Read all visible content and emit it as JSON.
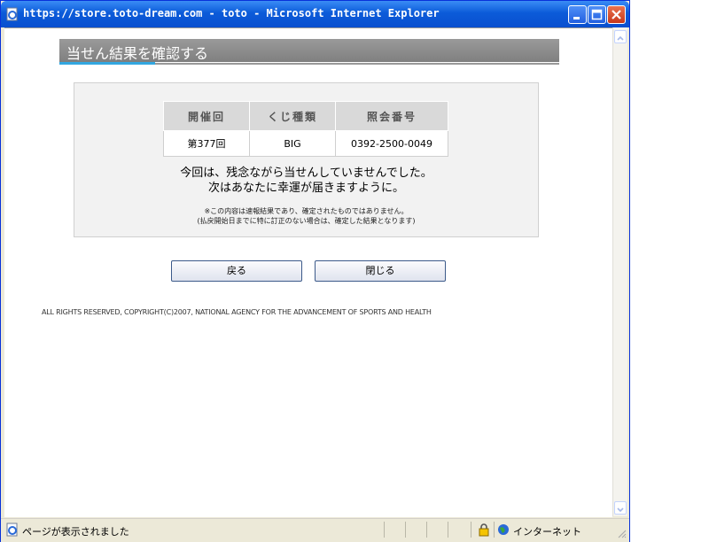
{
  "window": {
    "title": "https://store.toto-dream.com - toto - Microsoft Internet Explorer"
  },
  "page": {
    "heading": "当せん結果を確認する",
    "table": {
      "headers": [
        "開催回",
        "くじ種類",
        "照会番号"
      ],
      "row": [
        "第377回",
        "BIG",
        "0392-2500-0049"
      ]
    },
    "message_line1": "今回は、残念ながら当せんしていませんでした。",
    "message_line2": "次はあなたに幸運が届きますように。",
    "note_line1": "※この内容は速報結果であり、確定されたものではありません。",
    "note_line2": "(払戻開始日までに特に訂正のない場合は、確定した結果となります)",
    "back_button": "戻る",
    "close_button": "閉じる",
    "copyright": "ALL RIGHTS RESERVED, COPYRIGHT(C)2007, NATIONAL AGENCY FOR THE ADVANCEMENT OF SPORTS AND HEALTH"
  },
  "statusbar": {
    "status": "ページが表示されました",
    "zone": "インターネット"
  },
  "colors": {
    "titlebar": "#0b5bd9",
    "accent_blue": "#33a7e0",
    "heading_gray": "#8c8c8c"
  },
  "icons": [
    "ie-page-icon",
    "minimize-icon",
    "maximize-icon",
    "close-icon",
    "scroll-up-icon",
    "scroll-down-icon",
    "lock-icon",
    "globe-icon",
    "resize-grip-icon"
  ]
}
